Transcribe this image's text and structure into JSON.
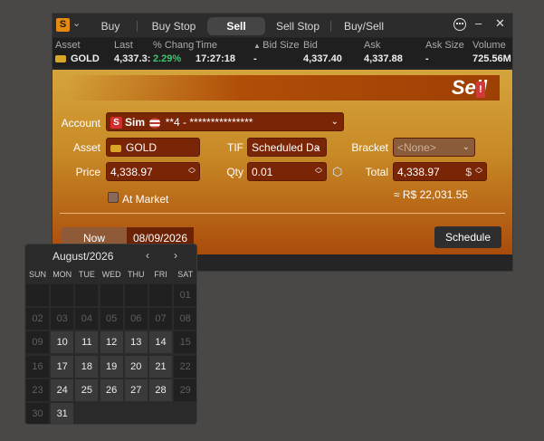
{
  "app": {
    "logo_letter": "S"
  },
  "tabs": [
    {
      "label": "Buy",
      "active": false
    },
    {
      "label": "Buy Stop",
      "active": false
    },
    {
      "label": "Sell",
      "active": true
    },
    {
      "label": "Sell Stop",
      "active": false
    },
    {
      "label": "Buy/Sell",
      "active": false
    }
  ],
  "window_controls": {
    "minimize": "–",
    "close": "✕"
  },
  "quote": {
    "headers": {
      "asset": "Asset",
      "last": "Last",
      "change": "% Chang",
      "time": "Time",
      "bid_size": "Bid Size",
      "bid": "Bid",
      "ask": "Ask",
      "ask_size": "Ask Size",
      "volume": "Volume"
    },
    "values": {
      "asset": "GOLD",
      "last": "4,337.3:",
      "change": "2.29%",
      "time": "17:27:18",
      "bid_size": "-",
      "bid": "4,337.40",
      "ask": "4,337.88",
      "ask_size": "-",
      "volume": "725.56M"
    }
  },
  "order": {
    "title": "Sell",
    "account_label": "Account",
    "account_sim": "Sim",
    "account_value": "**4 - ***************",
    "asset_label": "Asset",
    "asset_value": "GOLD",
    "tif_label": "TIF",
    "tif_value": "Scheduled Da",
    "bracket_label": "Bracket",
    "bracket_value": "<None>",
    "price_label": "Price",
    "price_value": "4,338.97",
    "qty_label": "Qty",
    "qty_value": "0.01",
    "total_label": "Total",
    "total_value": "4,338.97",
    "total_currency": "$",
    "at_market_label": "At Market",
    "approx_value": "≈ R$ 22,031.55",
    "warn_mark": "!"
  },
  "schedule": {
    "now_label": "Now",
    "date_value": "08/09/2026",
    "schedule_button": "Schedule"
  },
  "calendar": {
    "title": "August/2026",
    "prev": "‹",
    "next": "›",
    "weekdays": [
      "SUN",
      "MON",
      "TUE",
      "WED",
      "THU",
      "FRI",
      "SAT"
    ],
    "weeks": [
      [
        "",
        "",
        "",
        "",
        "",
        "",
        "01"
      ],
      [
        "02",
        "03",
        "04",
        "05",
        "06",
        "07",
        "08"
      ],
      [
        "09",
        "10",
        "11",
        "12",
        "13",
        "14",
        "15"
      ],
      [
        "16",
        "17",
        "18",
        "19",
        "20",
        "21",
        "22"
      ],
      [
        "23",
        "24",
        "25",
        "26",
        "27",
        "28",
        "29"
      ],
      [
        "30",
        "31",
        "",
        "",
        "",
        "",
        ""
      ]
    ],
    "enabled_days": [
      "10",
      "11",
      "12",
      "13",
      "14",
      "17",
      "18",
      "19",
      "20",
      "21",
      "24",
      "25",
      "26",
      "27",
      "28",
      "31"
    ]
  },
  "colors": {
    "accent": "#e58a12",
    "panel_top": "#d5a43c",
    "panel_bottom": "#a94c0c",
    "change_positive": "#3ec46d",
    "field_bg": "#7a2506"
  }
}
